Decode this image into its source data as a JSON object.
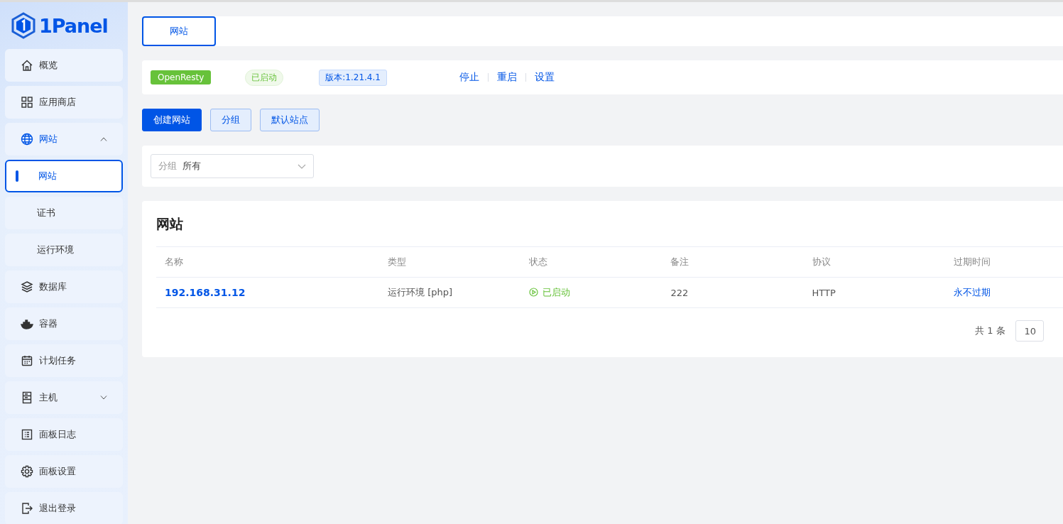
{
  "logo": {
    "text": "1Panel"
  },
  "sidebar": {
    "items": [
      {
        "kind": "home",
        "label": "概览",
        "selected": false
      },
      {
        "kind": "apps",
        "label": "应用商店",
        "selected": false
      },
      {
        "kind": "globe",
        "label": "网站",
        "selected": true,
        "expanded": true,
        "children": [
          {
            "label": "网站",
            "selected": true
          },
          {
            "label": "证书",
            "selected": false
          },
          {
            "label": "运行环境",
            "selected": false
          }
        ]
      },
      {
        "kind": "layers",
        "label": "数据库",
        "selected": false
      },
      {
        "kind": "container",
        "label": "容器",
        "selected": false
      },
      {
        "kind": "calendar",
        "label": "计划任务",
        "selected": false
      },
      {
        "kind": "server",
        "label": "主机",
        "selected": false,
        "expanded": false
      },
      {
        "kind": "log",
        "label": "面板日志",
        "selected": false
      },
      {
        "kind": "gear",
        "label": "面板设置",
        "selected": false
      },
      {
        "kind": "logout",
        "label": "退出登录",
        "selected": false
      }
    ]
  },
  "tabs": [
    {
      "label": "网站",
      "selected": true
    }
  ],
  "server_bar": {
    "app": "OpenResty",
    "status": "已启动",
    "version": "版本:1.21.4.1",
    "actions": [
      "停止",
      "重启",
      "设置"
    ]
  },
  "buttons": [
    {
      "label": "创建网站",
      "kind": "primary"
    },
    {
      "label": "分组",
      "kind": "plain"
    },
    {
      "label": "默认站点",
      "kind": "plain"
    }
  ],
  "filter": {
    "label": "分组",
    "value": "所有"
  },
  "table": {
    "title": "网站",
    "columns": [
      "名称",
      "类型",
      "状态",
      "备注",
      "协议",
      "过期时间"
    ],
    "rows": [
      {
        "name": "192.168.31.12",
        "type": "运行环境 [php]",
        "status": "已启动",
        "remark": "222",
        "protocol": "HTTP",
        "expiry": "永不过期"
      }
    ]
  },
  "pagination": {
    "total": "共 1 条",
    "page_size": "10"
  }
}
